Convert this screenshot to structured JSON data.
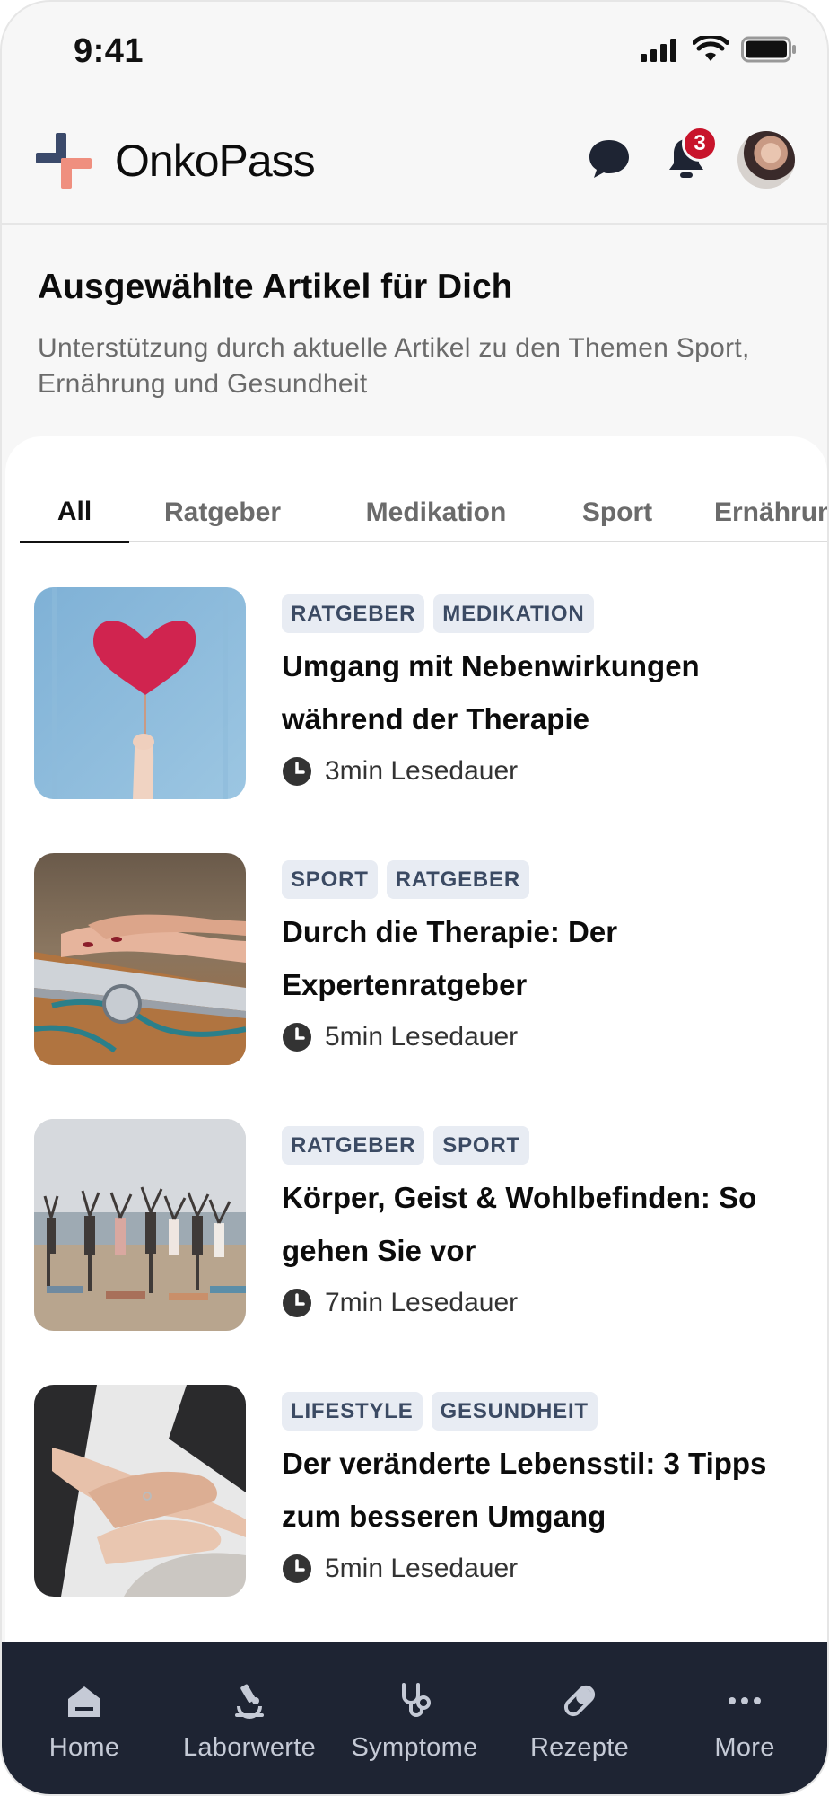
{
  "status_bar": {
    "time": "9:41"
  },
  "header": {
    "brand": "OnkoPass",
    "notification_count": "3",
    "accent_colors": {
      "logo_blue": "#3b4a6b",
      "logo_coral": "#ef8f7f",
      "badge": "#c8142b"
    }
  },
  "intro": {
    "title": "Ausgewählte Artikel für Dich",
    "subtitle": "Unterstützung durch aktuelle Artikel zu den Themen Sport, Ernährung und Gesundheit"
  },
  "tabs": [
    {
      "label": "All",
      "active": true
    },
    {
      "label": "Ratgeber",
      "active": false
    },
    {
      "label": "Medikation",
      "active": false
    },
    {
      "label": "Sport",
      "active": false
    },
    {
      "label": "Ernährun",
      "active": false
    }
  ],
  "articles": [
    {
      "tags": [
        "RATGEBER",
        "MEDIKATION"
      ],
      "title": "Umgang mit Nebenwirkungen während der Therapie",
      "read_time": "3min Lesedauer",
      "image": "heart-balloon"
    },
    {
      "tags": [
        "SPORT",
        "RATGEBER"
      ],
      "title": "Durch die Therapie: Der Expertenratgeber",
      "read_time": "5min Lesedauer",
      "image": "laptop-stethoscope"
    },
    {
      "tags": [
        "RATGEBER",
        "SPORT"
      ],
      "title": "Körper, Geist & Wohlbefinden: So gehen Sie vor",
      "read_time": "7min Lesedauer",
      "image": "beach-yoga"
    },
    {
      "tags": [
        "LIFESTYLE",
        "GESUNDHEIT"
      ],
      "title": "Der veränderte Lebensstil: 3 Tipps zum besseren Umgang",
      "read_time": "5min Lesedauer",
      "image": "holding-hands"
    }
  ],
  "bottom_nav": [
    {
      "label": "Home",
      "icon": "home-icon"
    },
    {
      "label": "Laborwerte",
      "icon": "microscope-icon"
    },
    {
      "label": "Symptome",
      "icon": "stethoscope-icon"
    },
    {
      "label": "Rezepte",
      "icon": "pill-icon"
    },
    {
      "label": "More",
      "icon": "more-icon"
    }
  ]
}
